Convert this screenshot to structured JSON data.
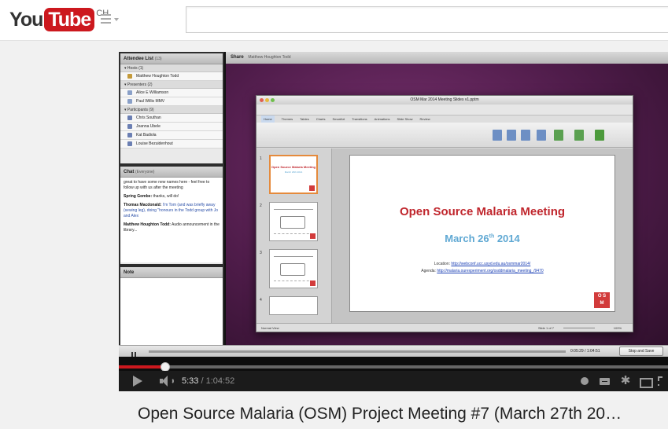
{
  "masthead": {
    "logo_you": "You",
    "logo_tube": "Tube",
    "logo_region": "CH",
    "search_value": ""
  },
  "meeting": {
    "attendee_list": {
      "title": "Attendee List",
      "count": "(13)"
    },
    "groups": {
      "hosts": "▾ Hosts (1)",
      "presenters": "▾ Presenters (2)",
      "participants": "▾ Participants (9)"
    },
    "hosts": [
      "Matthew Houghton Todd"
    ],
    "presenters": [
      "Alice E Williamson",
      "Paul Willis MMV"
    ],
    "participants": [
      "Chris Southan",
      "Joanna Ubele",
      "Kat Badiola",
      "Louise Bezuidenhout"
    ],
    "chat": {
      "title": "Chat",
      "scope": "(Everyone)",
      "messages": [
        {
          "author": "",
          "text": "great to have some new names here - feel free to follow up with us after the meeting"
        },
        {
          "author": "Spring Gombe:",
          "text": "thanks, will do!"
        },
        {
          "author": "Thomas Macdonald:",
          "text": "I'm Tom (and was briefly away (sewing leg), doing \"honours in the Todd group with Jo and Alex"
        },
        {
          "author": "Matthew Houghton Todd:",
          "text": "Audio announcement in the library..."
        }
      ]
    },
    "note": {
      "title": "Note"
    },
    "share": {
      "title": "Share",
      "owner": "Matthew Houghton Todd"
    },
    "ppt": {
      "window_title": "OSM Mar 2014 Meeting Slides v1.pptm",
      "tabs": [
        "Home",
        "Themes",
        "Tables",
        "Charts",
        "SmartArt",
        "Transitions",
        "Animations",
        "Slide Show",
        "Review"
      ],
      "active_tab": "Home",
      "thumb_numbers": [
        "1",
        "2",
        "3",
        "4"
      ],
      "thumb1_title": "Open Source Malaria Meeting",
      "thumb1_date": "March 26th 2014",
      "status_left": "Normal View",
      "status_slide": "Slide 1 of 7",
      "zoom": "109%"
    },
    "slide": {
      "title": "Open Source Malaria Meeting",
      "date_main": "March 26",
      "date_sup": "th",
      "date_year": " 2014",
      "location_label": "Location:",
      "location_url": "http://webconf.ucc.usyd.edu.au/osmmar2014/",
      "agenda_label": "Agenda:",
      "agenda_url": "http://malaria.ourexperiment.org/osddmalaria_meeting_/9470",
      "logo_top": "O S",
      "logo_bottom": "M"
    },
    "playback": {
      "time": "0:05:29 / 1:04:51",
      "stop_label": "Stop and Save"
    }
  },
  "player": {
    "played_fraction": 0.085,
    "current_time": "5:33",
    "duration": "1:04:52"
  },
  "video_title": "Open Source Malaria (OSM) Project Meeting #7 (March 27th 20…",
  "colors": {
    "brand_red": "#cc181e",
    "slide_title_red": "#c0262d",
    "slide_date_blue": "#5fa8d3"
  },
  "icons": [
    "guide-menu-icon",
    "play-icon",
    "volume-icon",
    "info-icon",
    "captions-icon",
    "settings-gear-icon",
    "theater-size-icon",
    "fullscreen-icon",
    "pause-icon"
  ]
}
